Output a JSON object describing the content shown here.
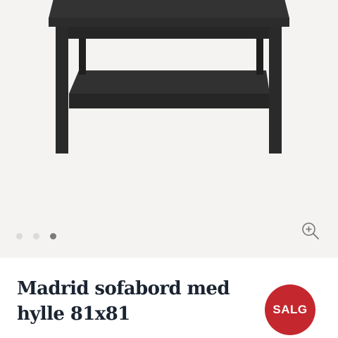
{
  "gallery": {
    "image_alt": "Madrid sofabord med hylle 81x81",
    "dots": [
      {
        "active": false
      },
      {
        "active": false
      },
      {
        "active": true
      }
    ],
    "zoom_icon": "zoom-in-icon"
  },
  "product": {
    "title": "Madrid sofabord med hylle 81x81",
    "badge": "SALG"
  },
  "colors": {
    "gallery_background": "#f4f3f1",
    "table": "#2b2b2b",
    "title": "#1b2431",
    "badge": "#c4272d",
    "dot_active": "#7d7b78",
    "dot_inactive": "#dcdad7"
  }
}
